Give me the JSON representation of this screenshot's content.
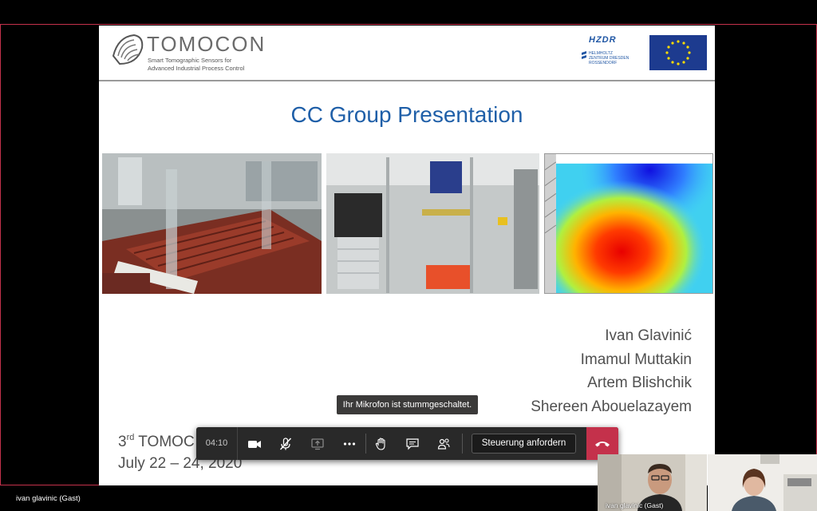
{
  "slide": {
    "brand_name": "TOMOCON",
    "brand_subtitle_1": "Smart Tomographic Sensors for",
    "brand_subtitle_2": "Advanced Industrial Process Control",
    "partner_logo": "HZDR",
    "partner_subtext_1": "HELMHOLTZ",
    "partner_subtext_2": "ZENTRUM DRESDEN",
    "partner_subtext_3": "ROSSENDORF",
    "title": "CC Group Presentation",
    "authors": [
      "Ivan Glavinić",
      "Imamul Muttakin",
      "Artem Blishchik",
      "Shereen Abouelazayem"
    ],
    "conference_prefix": "3",
    "conference_sup": "rd",
    "conference_visible": " TOMOC",
    "conference_date": "July 22 – 24, 2020"
  },
  "tooltip": "Ihr Mikrofon ist stummgeschaltet.",
  "controls": {
    "timer": "04:10",
    "camera_icon": "camera-icon",
    "mic_icon": "mic-muted-icon",
    "share_icon": "share-screen-icon",
    "more_icon": "more-icon",
    "hand_icon": "raise-hand-icon",
    "chat_icon": "chat-icon",
    "participants_icon": "participants-icon",
    "request_control": "Steuerung anfordern",
    "hangup_icon": "hang-up-icon"
  },
  "status": {
    "presenter": "ivan glavinic (Gast)"
  },
  "participants": [
    {
      "label": "ivan glavinic (Gast)"
    },
    {
      "label": ""
    }
  ],
  "colors": {
    "accent_red": "#c4314b",
    "title_blue": "#1f5fa8",
    "control_bg": "#292929"
  }
}
